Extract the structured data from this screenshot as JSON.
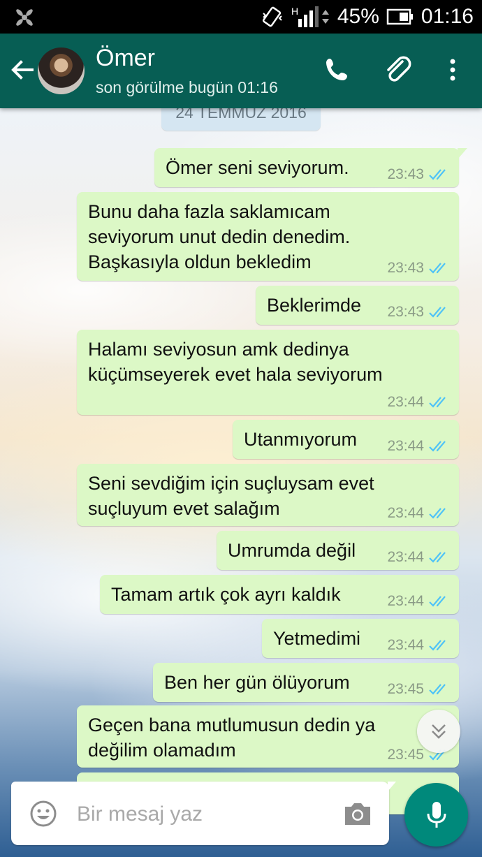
{
  "status_bar": {
    "network": "H",
    "battery_percent": "45%",
    "time": "01:16"
  },
  "header": {
    "contact_name": "Ömer",
    "last_seen": "son görülme bugün 01:16"
  },
  "chat": {
    "date_chip": "24 TEMMUZ 2016",
    "messages": [
      {
        "text": "Ömer seni seviyorum.",
        "time": "23:43",
        "status": "read"
      },
      {
        "text": "Bunu daha fazla saklamıcam\nseviyorum unut dedin denedim.\nBaşkasıyla oldun bekledim",
        "time": "23:43",
        "status": "read"
      },
      {
        "text": "Beklerimde",
        "time": "23:43",
        "status": "read"
      },
      {
        "text": "Halamı seviyosun amk dedinya\nküçümseyerek evet hala seviyorum",
        "time": "23:44",
        "status": "read"
      },
      {
        "text": "Utanmıyorum",
        "time": "23:44",
        "status": "read"
      },
      {
        "text": "Seni sevdiğim için suçluysam evet\nsuçluyum evet salağım",
        "time": "23:44",
        "status": "read"
      },
      {
        "text": "Umrumda değil",
        "time": "23:44",
        "status": "read"
      },
      {
        "text": "Tamam artık çok ayrı kaldık",
        "time": "23:44",
        "status": "read"
      },
      {
        "text": "Yetmedimi",
        "time": "23:44",
        "status": "read"
      },
      {
        "text": "Ben her gün ölüyorum",
        "time": "23:45",
        "status": "read"
      },
      {
        "text": "Geçen bana mutlumusun dedin ya\ndeğilim olamadım",
        "time": "23:45",
        "status": "read"
      }
    ]
  },
  "input": {
    "placeholder": "Bir mesaj yaz"
  },
  "colors": {
    "header": "#075e54",
    "bubble": "#dcf8c6",
    "read_ticks": "#4fc3f7",
    "mic_button": "#00897b"
  },
  "icons": [
    "app-notification-icon",
    "vibrate-icon",
    "signal-icon",
    "battery-icon",
    "back-arrow-icon",
    "call-icon",
    "attach-icon",
    "more-icon",
    "double-check-icon",
    "scroll-down-icon",
    "emoji-icon",
    "camera-icon",
    "mic-icon"
  ]
}
